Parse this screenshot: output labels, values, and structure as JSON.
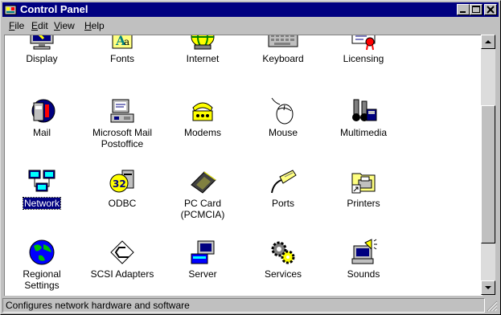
{
  "window": {
    "title": "Control Panel"
  },
  "menu": [
    {
      "label_u": "F",
      "label_rest": "ile"
    },
    {
      "label_u": "E",
      "label_rest": "dit"
    },
    {
      "label_u": "V",
      "label_rest": "iew"
    },
    {
      "label_u": "H",
      "label_rest": "elp"
    }
  ],
  "items": [
    {
      "label": "Display",
      "icon": "display-icon"
    },
    {
      "label": "Fonts",
      "icon": "fonts-icon"
    },
    {
      "label": "Internet",
      "icon": "internet-icon"
    },
    {
      "label": "Keyboard",
      "icon": "keyboard-icon"
    },
    {
      "label": "Licensing",
      "icon": "licensing-icon"
    },
    {
      "label": "Mail",
      "icon": "mail-icon"
    },
    {
      "label": "Microsoft Mail",
      "label2": "Postoffice",
      "icon": "postoffice-icon"
    },
    {
      "label": "Modems",
      "icon": "modem-icon"
    },
    {
      "label": "Mouse",
      "icon": "mouse-icon"
    },
    {
      "label": "Multimedia",
      "icon": "multimedia-icon"
    },
    {
      "label": "Network",
      "icon": "network-icon",
      "selected": true
    },
    {
      "label": "ODBC",
      "icon": "odbc-icon"
    },
    {
      "label": "PC Card",
      "label2": "(PCMCIA)",
      "icon": "pc-card-icon"
    },
    {
      "label": "Ports",
      "icon": "ports-icon"
    },
    {
      "label": "Printers",
      "icon": "printers-folder-icon"
    },
    {
      "label": "Regional",
      "label2": "Settings",
      "icon": "globe-icon"
    },
    {
      "label": "SCSI Adapters",
      "icon": "scsi-icon"
    },
    {
      "label": "Server",
      "icon": "server-icon"
    },
    {
      "label": "Services",
      "icon": "gears-icon"
    },
    {
      "label": "Sounds",
      "icon": "sound-icon"
    }
  ],
  "status": {
    "text": "Configures network hardware and software"
  }
}
